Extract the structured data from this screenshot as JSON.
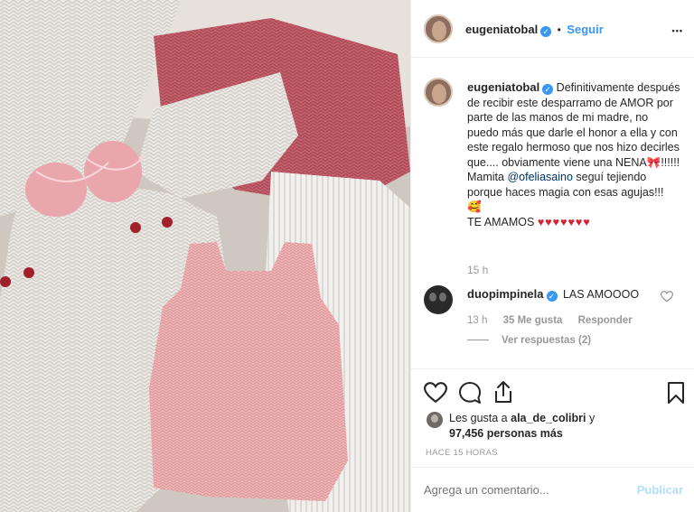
{
  "post_header": {
    "username": "eugeniatobal",
    "follow_label": "Seguir",
    "dot_separator": "•",
    "more_label": "•••"
  },
  "caption": {
    "username": "eugeniatobal",
    "text_part1": "Definitivamente después de recibir este desparramo de AMOR por parte de las manos de mi madre, no puedo más que darle el honor a ella y con este regalo hermoso que nos hizo decirles que.... obviamente viene una NENA",
    "emoji_bow": "🎀",
    "text_part2": "!!!!!! Mamita ",
    "mention": "@ofeliasaino",
    "text_part3": " seguí tejiendo porque haces magia con esas agujas!!!",
    "emoji_face": "🥰",
    "text_part4": "TE AMAMOS",
    "hearts": "♥♥♥♥♥♥♥",
    "time": "15 h"
  },
  "comment": {
    "username": "duopimpinela",
    "text": "LAS AMOOOO",
    "time": "13 h",
    "likes": "35 Me gusta",
    "reply_label": "Responder",
    "view_replies": "Ver respuestas (2)"
  },
  "likes": {
    "prefix": "Les gusta a",
    "user": "ala_de_colibri",
    "joiner": "y",
    "count": "97,456 personas más"
  },
  "posted": "HACE 15 HORAS",
  "add_comment": {
    "placeholder": "Agrega un comentario...",
    "publish_label": "Publicar"
  },
  "colors": {
    "link_blue": "#3897f0",
    "text_dark": "#262626",
    "muted_gray": "#999999",
    "heart_red": "#d6212f",
    "publish_disabled": "#b2dffc"
  }
}
